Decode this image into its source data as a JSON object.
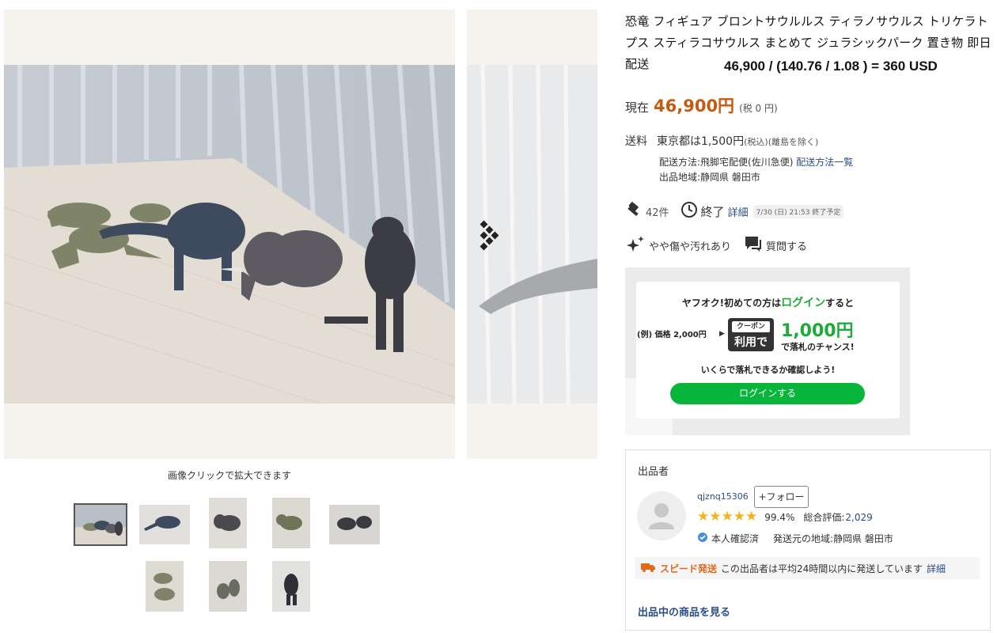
{
  "gallery": {
    "caption": "画像クリックで拡大できます",
    "thumbnail_count": 8,
    "active_thumbnail": 1
  },
  "item": {
    "title": "恐竜 フィギュア ブロントサウルルス ティラノサウルス トリケラトプス スティラコサウルス まとめて ジュラシックパーク 置き物 即日配送",
    "usd_conversion": "46,900 / (140.76 / 1.08 ) = 360 USD",
    "price_label": "現在",
    "price_value": "46,900円",
    "price_tax": "(税 0 円)"
  },
  "shipping": {
    "label": "送料",
    "region": "東京都は1,500円",
    "tax_note": "(税込)",
    "exclusion": "(離島を除く)",
    "method_label": "配送方法:飛脚宅配便(佐川急便)",
    "method_link": "配送方法一覧",
    "origin": "出品地域:静岡県 磐田市"
  },
  "status": {
    "bids": "42件",
    "ended": "終了",
    "detail_link": "詳細",
    "end_time": "7/30 (日) 21:53 終了予定",
    "condition": "やや傷や汚れあり",
    "question": "質問する"
  },
  "coupon": {
    "line_before": "ヤフオク!初めての方は",
    "login_word": "ログイン",
    "line_after": "すると",
    "example_price": "(例) 価格 2,000円",
    "tag_top": "クーポン",
    "tag_main": "利用で",
    "amount": "1,000円",
    "chance": "で落札のチャンス!",
    "check": "いくらで落札できるか確認しよう!",
    "login_button": "ログインする"
  },
  "seller": {
    "heading": "出品者",
    "id": "qjznq15306",
    "follow": "+フォロー",
    "rating_stars": 5,
    "positive_rate": "99.4%",
    "total_label": "総合評価:",
    "total_value": "2,029",
    "verified": "本人確認済",
    "ship_from": "発送元の地域:静岡県 磐田市",
    "speed_title": "スピード発送",
    "speed_text": "この出品者は平均24時間以内に発送しています",
    "speed_link": "詳細",
    "items_link": "出品中の商品を見る"
  },
  "colors": {
    "price": "#c55a11",
    "link": "#2a4d86",
    "green": "#1eaa39",
    "star": "#f3b31a"
  }
}
